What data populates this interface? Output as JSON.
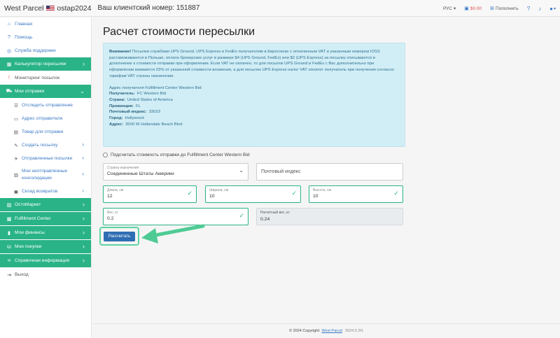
{
  "topbar": {
    "brand": "West Parcel",
    "username": "ostap2024",
    "client_number": "Ваш клиентский номер: 151887",
    "lang": "РУС",
    "balance": "$0.00",
    "topup": "Пополнить",
    "help_icon": "?",
    "bell_icon": "bell",
    "user_icon": "user"
  },
  "sidebar": {
    "home": "Главная",
    "help": "Помощь",
    "support": "Служба поддержки",
    "calculator": "Калькулятор пересылки",
    "monitoring": "Мониторинг посылок",
    "my_shipments": "Мои отправки",
    "sub": {
      "track": "Отследить отправление",
      "sender_address": "Адрес отправителя",
      "goods": "Товар для отправки",
      "create": "Создать посылку",
      "sent": "Отправленные посылки",
      "unsent_line1": "Мои неотправленные",
      "unsent_line2": "консолидации",
      "returns": "Склад возвратов"
    },
    "ostomarket": "ОстоМаркет",
    "fulfillment": "Fulfillment Center",
    "finance": "Мои финансы",
    "purchases": "Мои покупки",
    "reference": "Справочная информация",
    "logout": "Выход"
  },
  "main": {
    "title": "Расчет стоимости пересылки",
    "alert": {
      "attention": "Внимание!",
      "text": " Посылки службами UPS Ground, UPS Express и FedEx получателям в Евросоюзе с оплаченным VAT и указанным номером IOSS растаможиваются в Польше, оплата брокерских услуг в размере $4 (UPS Ground, FedEx) или $2 (UPS Express) за посылку списываются в дополнение к стоимости отправки при оформлении. Если VAT не оплачен, то для посылок UPS Ground и FedEx с Вас дополнительно при оформлении взимается 23% от указанной стоимости вложения, а для посылок UPS Express налог VAT оплатит получатель при получении согласно тарифам VAT страны назначения.",
      "addr_title": "Адрес получателя Fulfillment Center Western Bid:",
      "recipient_k": "Получатель:",
      "recipient_v": "FC Western Bid",
      "country_k": "Страна:",
      "country_v": "United States of America",
      "province_k": "Провинция:",
      "province_v": "FL",
      "zip_k": "Почтовый индекс:",
      "zip_v": "33023",
      "city_k": "Город:",
      "city_v": "Hollywood",
      "address_k": "Адрес:",
      "address_v": "3500 W Hallandale Beach Blvd"
    },
    "checkbox_label": "Подсчитать стоимость отправки до Fulfillment Center Western Bid",
    "country_label": "Страна назначения",
    "country_value": "Соединенные Штаты Америки",
    "zip_placeholder": "Почтовый индекс",
    "length_label": "Длина, см",
    "length_value": "12",
    "width_label": "Ширина, см",
    "width_value": "10",
    "height_label": "Высота, см",
    "height_value": "10",
    "weight_label": "Вес, кг",
    "weight_value": "0.2",
    "calc_weight_label": "Расчётный вес, кг:",
    "calc_weight_value": "0.24",
    "calculate_button": "Рассчитать"
  },
  "footer": {
    "copyright": "© 2024 Copyright:",
    "link": "West Parcel",
    "version": "2024.5.2f1"
  },
  "colors": {
    "accent_green": "#29b386",
    "arrow_green": "#4ecb94",
    "button_blue": "#2f6db3",
    "alert_bg": "#d1eef6"
  }
}
